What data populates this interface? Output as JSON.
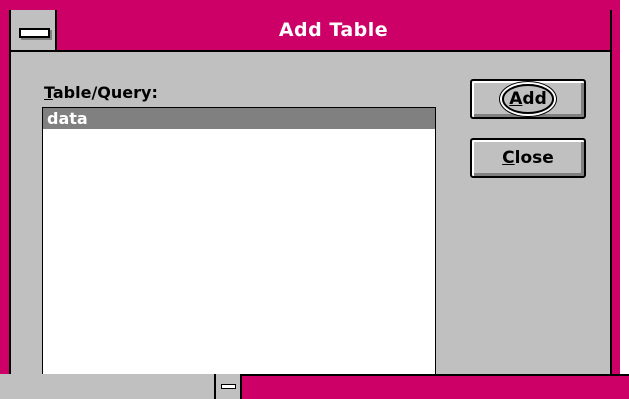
{
  "window": {
    "title": "Add Table"
  },
  "list": {
    "label_underlined": "T",
    "label_rest": "able/Query:",
    "items": [
      "data"
    ],
    "selected": "data"
  },
  "buttons": {
    "add_underlined": "A",
    "add_rest": "dd",
    "close_underlined": "C",
    "close_rest": "lose"
  },
  "colors": {
    "title_bar": "#cc0066",
    "face": "#c0c0c0",
    "selection": "#808080"
  },
  "icons": {
    "system_menu": "system-menu-icon"
  }
}
